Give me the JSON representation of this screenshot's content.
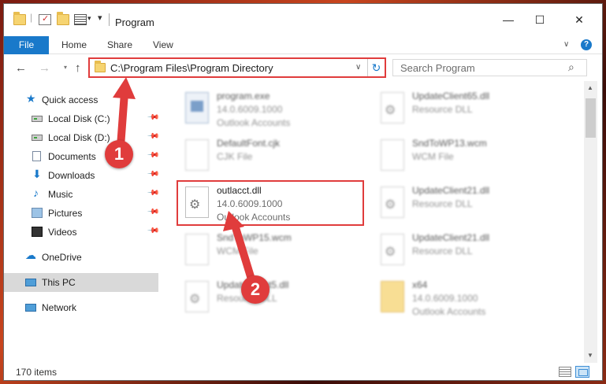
{
  "titlebar": {
    "title": "Program",
    "minimize": "—",
    "maximize": "☐",
    "close": "✕"
  },
  "ribbon": {
    "tabs": [
      "File",
      "Home",
      "Share",
      "View"
    ],
    "help": "?"
  },
  "nav": {
    "back": "←",
    "forward": "→",
    "up": "↑"
  },
  "address": {
    "path": "C:\\Program Files\\Program Directory",
    "refresh": "↻"
  },
  "search": {
    "placeholder": "Search Program",
    "icon": "search-icon"
  },
  "sidebar": {
    "items": [
      {
        "label": "Quick access",
        "icon": "star-icon"
      },
      {
        "label": "Local Disk (C:)",
        "icon": "disk-icon",
        "pinned": true
      },
      {
        "label": "Local Disk (D:)",
        "icon": "disk-icon",
        "pinned": true
      },
      {
        "label": "Documents",
        "icon": "documents-icon",
        "pinned": true
      },
      {
        "label": "Downloads",
        "icon": "download-icon",
        "pinned": true
      },
      {
        "label": "Music",
        "icon": "music-icon",
        "pinned": true
      },
      {
        "label": "Pictures",
        "icon": "pictures-icon",
        "pinned": true
      },
      {
        "label": "Videos",
        "icon": "videos-icon",
        "pinned": true
      },
      {
        "label": "OneDrive",
        "icon": "cloud-icon"
      },
      {
        "label": "This PC",
        "icon": "computer-icon",
        "selected": true
      },
      {
        "label": "Network",
        "icon": "network-icon"
      }
    ]
  },
  "files": {
    "left": [
      {
        "name": "program.exe",
        "line2": "14.0.6009.1000",
        "line3": "Outlook Accounts",
        "icon": "exe-icon"
      },
      {
        "name": "DefaultFont.cjk",
        "line2": "CJK File",
        "line3": "",
        "icon": "file-icon"
      },
      {
        "name": "outlacct.dll",
        "line2": "14.0.6009.1000",
        "line3": "Outlook Accounts",
        "icon": "dll-icon"
      },
      {
        "name": "SndToWP15.wcm",
        "line2": "WCM File",
        "line3": "",
        "icon": "file-icon"
      },
      {
        "name": "UpdateClient5.dll",
        "line2": "Resource DLL",
        "line3": "",
        "icon": "dll-icon"
      }
    ],
    "right": [
      {
        "name": "UpdateClient65.dll",
        "line2": "Resource DLL",
        "line3": "",
        "icon": "dll-icon"
      },
      {
        "name": "SndToWP13.wcm",
        "line2": "WCM File",
        "line3": "",
        "icon": "file-icon"
      },
      {
        "name": "UpdateClient21.dll",
        "line2": "Resource DLL",
        "line3": "",
        "icon": "dll-icon"
      },
      {
        "name": "UpdateClient21.dll",
        "line2": "Resource DLL",
        "line3": "",
        "icon": "dll-icon"
      },
      {
        "name": "x64",
        "line2": "14.0.6009.1000",
        "line3": "Outlook Accounts",
        "icon": "folder-icon"
      }
    ]
  },
  "status": {
    "count": "170 items"
  },
  "annotations": {
    "marker1": "1",
    "marker2": "2",
    "color": "#e03c3c"
  },
  "colors": {
    "accent": "#1979ca",
    "highlight": "#e03c3c"
  }
}
